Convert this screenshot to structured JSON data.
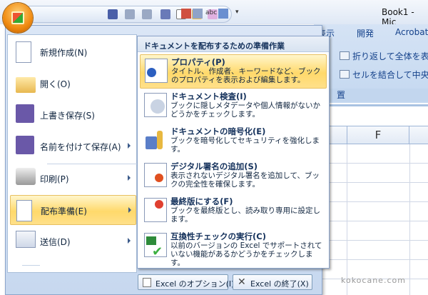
{
  "window": {
    "title": "Book1 - Mic"
  },
  "quick_access": {
    "icons": [
      "save-icon",
      "undo-icon",
      "redo-icon",
      "print-preview-icon",
      "new-icon",
      "open-icon",
      "insert-object-icon",
      "form-icon",
      "table-icon",
      "spelling-icon",
      "sort-icon",
      "customize-icon"
    ]
  },
  "ribbon": {
    "tabs": [
      "表示",
      "開発",
      "Acrobat"
    ],
    "buttons": [
      "折り返して全体を表示す",
      "セルを結合して中央揃え"
    ],
    "group_label": "置"
  },
  "sheet": {
    "column": "F"
  },
  "office_menu": {
    "left_items": [
      {
        "label": "新規作成(N)",
        "icon": "new-document-icon",
        "submenu": false
      },
      {
        "label": "開く(O)",
        "icon": "open-folder-icon",
        "submenu": false
      },
      {
        "label": "上書き保存(S)",
        "icon": "save-icon",
        "submenu": false
      },
      {
        "label": "名前を付けて保存(A)",
        "icon": "save-as-icon",
        "submenu": true
      },
      {
        "label": "印刷(P)",
        "icon": "printer-icon",
        "submenu": true
      },
      {
        "label": "配布準備(E)",
        "icon": "prepare-icon",
        "submenu": true,
        "selected": true
      },
      {
        "label": "送信(D)",
        "icon": "send-icon",
        "submenu": true
      }
    ],
    "submenu": {
      "header": "ドキュメントを配布するための準備作業",
      "items": [
        {
          "title": "プロパティ(P)",
          "desc": "タイトル、作成者、キーワードなど、ブックのプロパティを表示および編集します。",
          "icon": "properties-icon",
          "selected": true
        },
        {
          "title": "ドキュメント検査(I)",
          "desc": "ブックに隠しメタデータや個人情報がないかどうかをチェックします。",
          "icon": "inspect-document-icon"
        },
        {
          "title": "ドキュメントの暗号化(E)",
          "desc": "ブックを暗号化してセキュリティを強化します。",
          "icon": "encrypt-lock-icon"
        },
        {
          "title": "デジタル署名の追加(S)",
          "desc": "表示されないデジタル署名を追加して、ブックの完全性を確保します。",
          "icon": "digital-signature-icon"
        },
        {
          "title": "最終版にする(F)",
          "desc": "ブックを最終版とし、読み取り専用に設定します。",
          "icon": "mark-final-icon"
        },
        {
          "title": "互換性チェックの実行(C)",
          "desc": "以前のバージョンの Excel でサポートされていない機能があるかどうかをチェックします。",
          "icon": "compatibility-check-icon"
        }
      ]
    },
    "options_button": "Excel のオプション(I)",
    "exit_button": "Excel の終了(X)"
  },
  "watermark": "kokocane.com",
  "colors": {
    "highlight": "#ffd96b",
    "ribbon": "#c4d8f0",
    "text": "#15428b"
  }
}
